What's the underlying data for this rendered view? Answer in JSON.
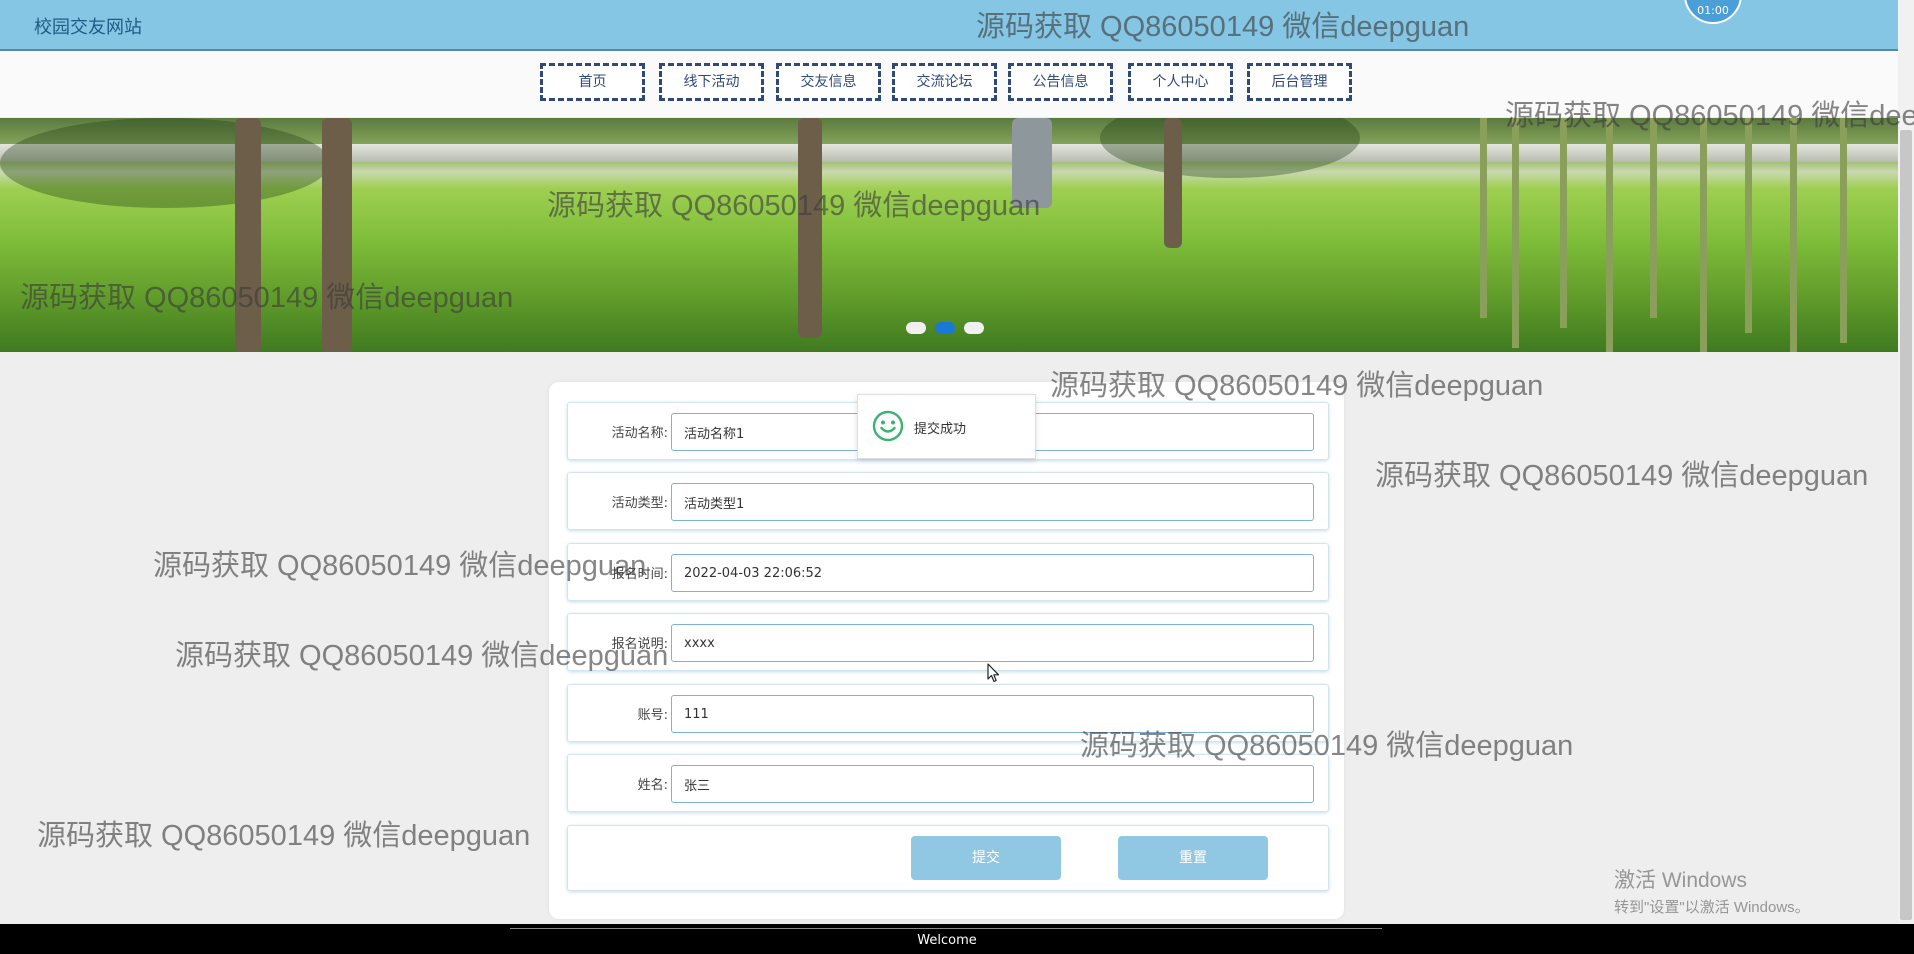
{
  "header": {
    "site_title": "校园交友网站",
    "avatar_text": "01:00"
  },
  "nav": {
    "items": [
      {
        "label": "首页"
      },
      {
        "label": "线下活动"
      },
      {
        "label": "交友信息"
      },
      {
        "label": "交流论坛"
      },
      {
        "label": "公告信息"
      },
      {
        "label": "个人中心"
      },
      {
        "label": "后台管理"
      }
    ]
  },
  "banner": {
    "active_slide": 2,
    "slide_count": 3
  },
  "form": {
    "fields": [
      {
        "label": "活动名称:",
        "value": "活动名称1"
      },
      {
        "label": "活动类型:",
        "value": "活动类型1"
      },
      {
        "label": "报名时间:",
        "value": "2022-04-03 22:06:52"
      },
      {
        "label": "报名说明:",
        "value": "xxxx"
      },
      {
        "label": "账号:",
        "value": "111"
      },
      {
        "label": "姓名:",
        "value": "张三"
      }
    ],
    "submit_label": "提交",
    "reset_label": "重置"
  },
  "toast": {
    "message": "提交成功",
    "icon": "smile-icon"
  },
  "footer": {
    "text": "Welcome"
  },
  "watermark": {
    "text": "源码获取 QQ86050149 微信deepguan"
  },
  "os_overlay": {
    "line1": "激活 Windows",
    "line2": "转到\"设置\"以激活 Windows。"
  },
  "colors": {
    "header_bg": "#85c6e4",
    "nav_border": "#2f4a78",
    "button_bg": "#90c8e4",
    "active_dot": "#1a78d6",
    "footer_bg": "#000000"
  }
}
